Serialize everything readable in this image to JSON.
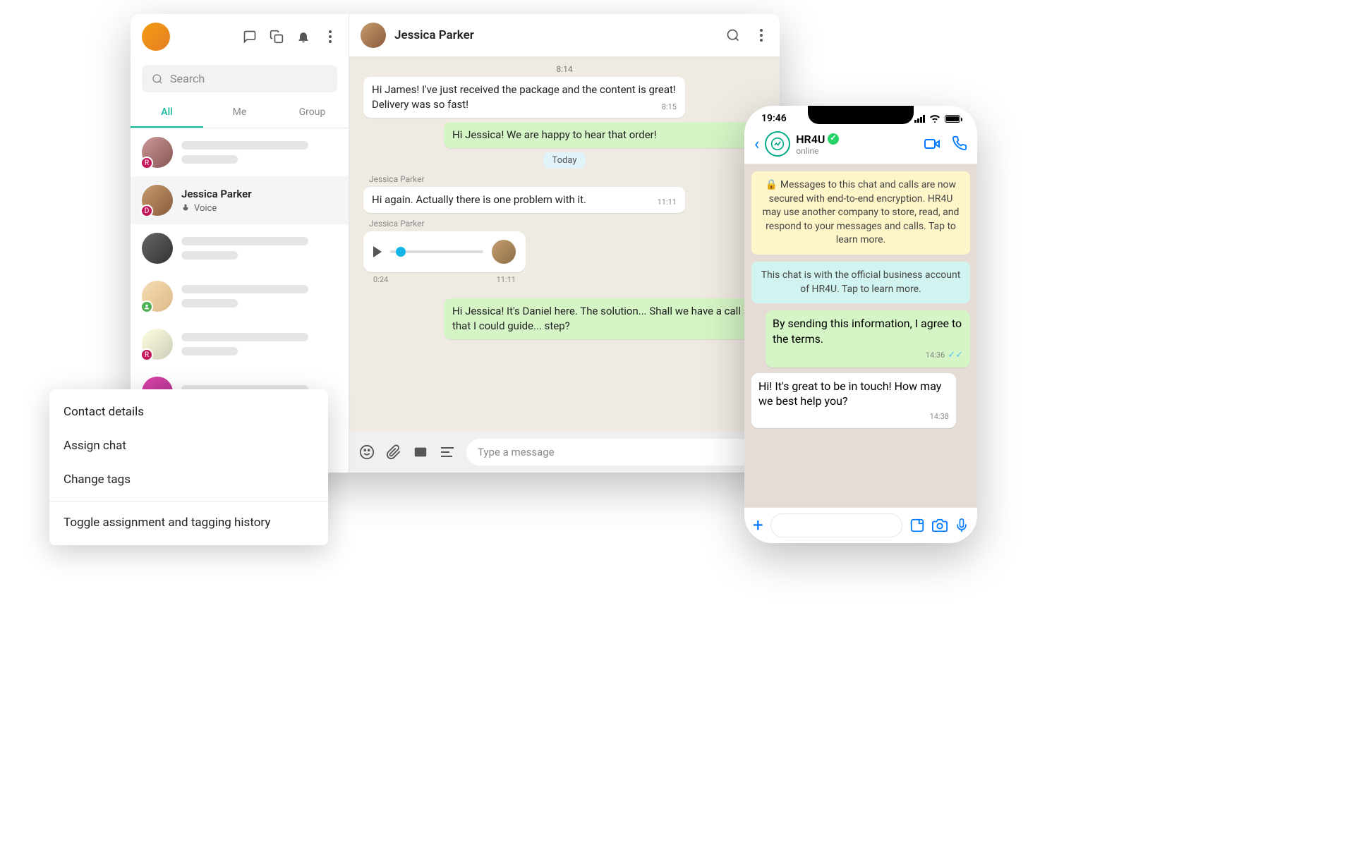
{
  "desktop": {
    "search_placeholder": "Search",
    "tabs": [
      "All",
      "Me",
      "Group"
    ],
    "active_tab": 0,
    "chat_list": {
      "selected": {
        "name": "Jessica Parker",
        "preview_label": "Voice",
        "badge_letter": "D"
      },
      "badges": [
        "R",
        "D",
        "",
        "",
        "R"
      ]
    },
    "conversation": {
      "title": "Jessica Parker",
      "messages": {
        "time_top": "8:14",
        "m1": {
          "text": "Hi James! I've just received the package and the content is great! Delivery was so fast!",
          "time": "8:15"
        },
        "m2": {
          "text": "Hi Jessica! We are happy to hear that order!"
        },
        "date_chip": "Today",
        "sender1": "Jessica Parker",
        "m3": {
          "text": "Hi again. Actually there is one problem with it.",
          "time": "11:11"
        },
        "sender2": "Jessica Parker",
        "voice": {
          "duration": "0:24",
          "time": "11:11"
        },
        "m4": {
          "text": "Hi Jessica! It's Daniel here. The solution... Shall we have a call so that I could guide... step?"
        }
      },
      "composer_placeholder": "Type a message"
    }
  },
  "context_menu": {
    "items": [
      "Contact details",
      "Assign chat",
      "Change tags",
      "Toggle assignment and tagging history"
    ]
  },
  "phone": {
    "status_time": "19:46",
    "header": {
      "name": "HR4U",
      "sub": "online"
    },
    "encryption_notice": "🔒 Messages to this chat and calls are now secured with end-to-end encryption. HR4U may use another company to store, read, and respond to your messages and calls. Tap to learn more.",
    "business_notice": "This chat is with the official business account of HR4U. Tap to learn more.",
    "m_out": {
      "text": "By sending this information, I agree to the terms.",
      "time": "14:36"
    },
    "m_in": {
      "text": "Hi! It's great to be in touch! How may we best help you?",
      "time": "14:38"
    }
  }
}
